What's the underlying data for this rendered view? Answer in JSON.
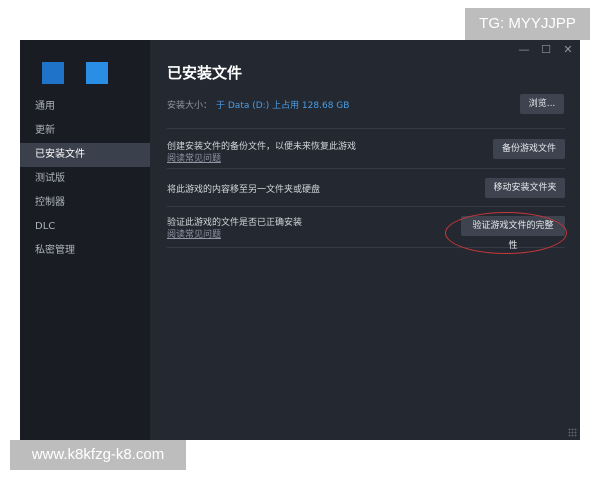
{
  "watermarks": {
    "top": "TG: MYYJJPP",
    "bottom": "www.k8kfzg-k8.com"
  },
  "window": {
    "controls": {
      "minimize": "—",
      "maximize": "☐",
      "close": "✕"
    }
  },
  "sidebar": {
    "items": [
      {
        "label": "通用",
        "active": false
      },
      {
        "label": "更新",
        "active": false
      },
      {
        "label": "已安装文件",
        "active": true
      },
      {
        "label": "测试版",
        "active": false
      },
      {
        "label": "控制器",
        "active": false
      },
      {
        "label": "DLC",
        "active": false
      },
      {
        "label": "私密管理",
        "active": false
      }
    ]
  },
  "main": {
    "title": "已安装文件",
    "install_size_label": "安装大小：",
    "install_size_value": "于 Data (D:) 上占用 128.68 GB",
    "browse_button": "浏览...",
    "rows": [
      {
        "text": "创建安装文件的备份文件，以便未来恢复此游戏",
        "link": "阅读常见问题",
        "button": "备份游戏文件"
      },
      {
        "text": "将此游戏的内容移至另一文件夹或硬盘",
        "button": "移动安装文件夹"
      },
      {
        "text": "验证此游戏的文件是否已正确安装",
        "link": "阅读常见问题",
        "button": "验证游戏文件的完整性"
      }
    ]
  },
  "colors": {
    "accent": "#4a9ee8",
    "highlight_circle": "#c8373a"
  }
}
